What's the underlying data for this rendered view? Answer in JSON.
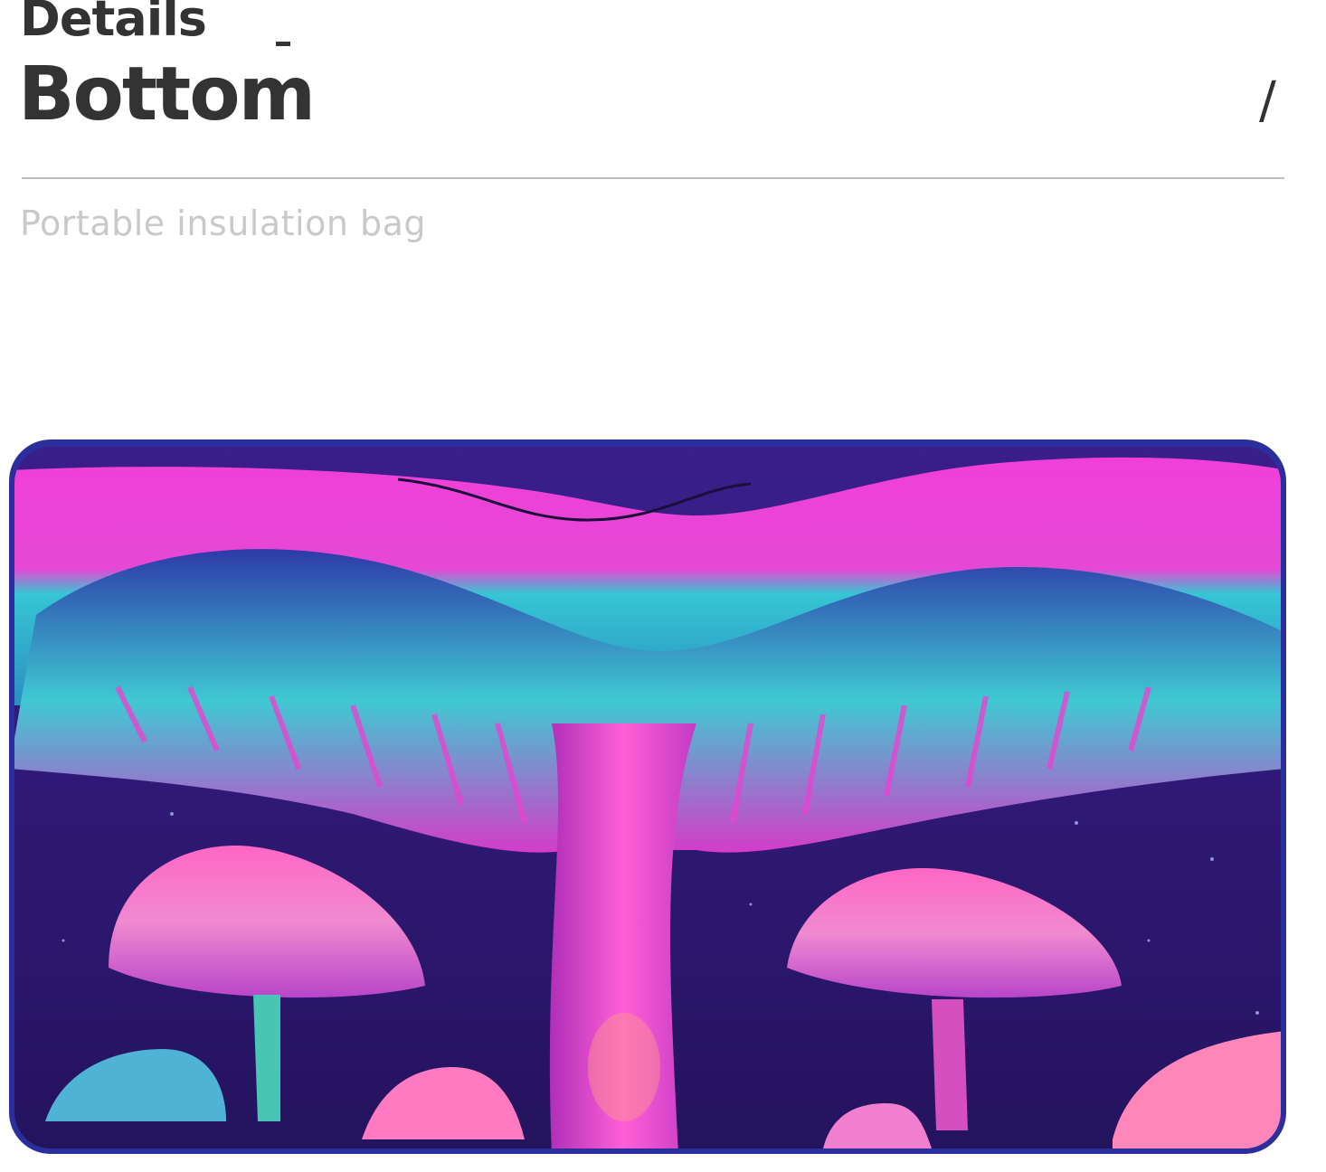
{
  "header": {
    "label": "Details",
    "title": "Bottom",
    "slash": "/",
    "subtitle": "Portable insulation bag"
  },
  "product_image": {
    "alt": "Psychedelic neon mushroom print on the bottom panel of the insulation bag",
    "colors": {
      "background": "#2a1870",
      "magenta": "#e63bd2",
      "pink": "#ff6fc8",
      "cyan": "#3fd4d0",
      "teal": "#2aa6b8",
      "deep_blue": "#2c2fa8",
      "orange": "#ff9a6a"
    }
  }
}
